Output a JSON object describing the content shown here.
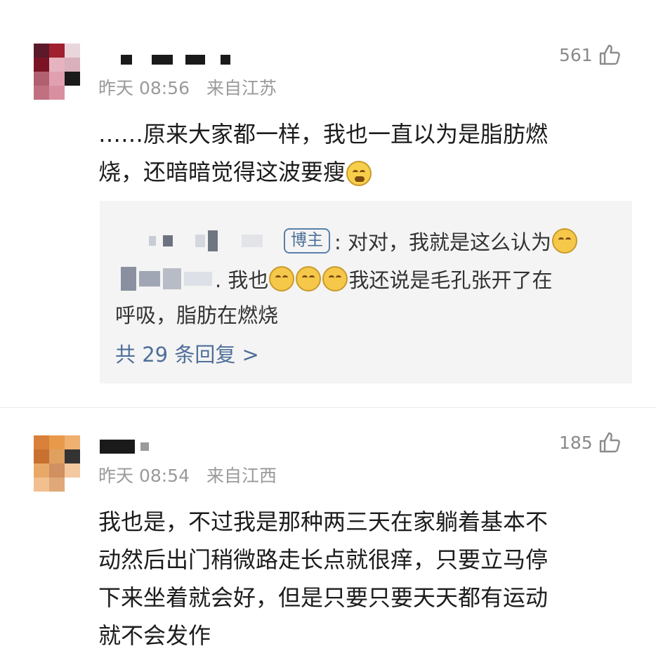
{
  "comments": [
    {
      "time": "昨天 08:56",
      "location": "来自江苏",
      "likes": "561",
      "text_lines": [
        "……原来大家都一样，我也一直以为是脂肪燃",
        "烧，还暗暗觉得这波要瘦"
      ],
      "replies": {
        "author_badge": "博主",
        "reply1_text": ": 对对，我就是这么认为",
        "reply2_prefix": ". 我也",
        "reply2_text": "我还说是毛孔张开了在",
        "reply2_text2": "呼吸，脂肪在燃烧",
        "more": "共 29 条回复 >"
      }
    },
    {
      "time": "昨天 08:54",
      "location": "来自江西",
      "likes": "185",
      "text_lines": [
        "我也是，不过我是那种两三天在家躺着基本不",
        "动然后出门稍微路走长点就很痒，只要立马停",
        "下来坐着就会好，但是只要只要天天都有运动",
        "就不会发作"
      ]
    }
  ],
  "icons": {
    "like": "thumbs-up-icon",
    "emoji_cry": "crying-face-icon",
    "emoji_laugh": "laughing-crying-face-icon",
    "emoji_pray": "pray-face-icon"
  },
  "colors": {
    "link": "#4f6f9a",
    "meta": "#9a9a9a",
    "reply_bg": "#f4f4f4"
  }
}
